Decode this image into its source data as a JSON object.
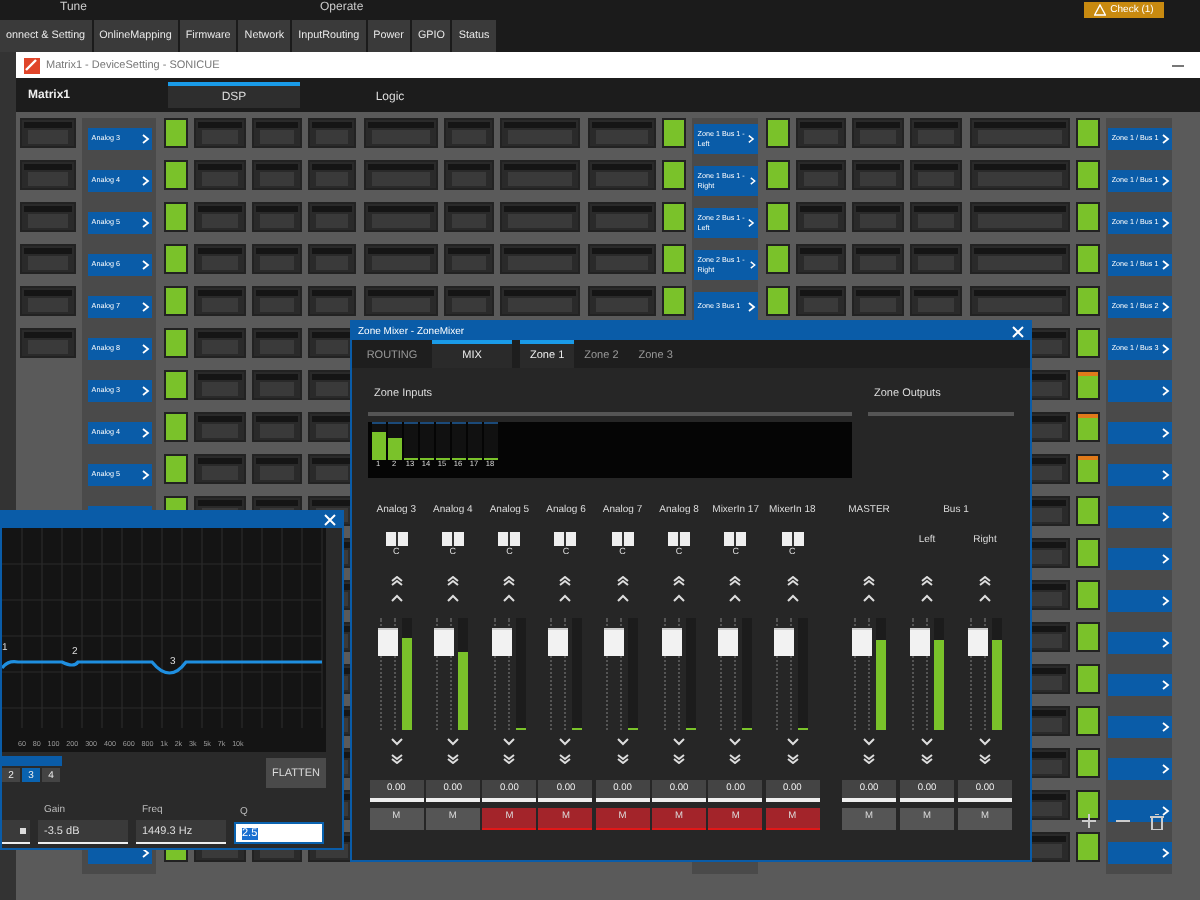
{
  "top_bar": {
    "items": [
      "Tune",
      "Operate"
    ],
    "check_button": "Check (1)"
  },
  "tabs": [
    {
      "label": "onnect & Setting",
      "selected": false
    },
    {
      "label": "OnlineMapping",
      "selected": false
    },
    {
      "label": "Firmware",
      "selected": false
    },
    {
      "label": "Network",
      "selected": false
    },
    {
      "label": "InputRouting",
      "selected": false
    },
    {
      "label": "Power",
      "selected": false
    },
    {
      "label": "GPIO",
      "selected": false
    },
    {
      "label": "Status",
      "selected": false
    }
  ],
  "window": {
    "title": "Matrix1 - DeviceSetting - SONICUE",
    "device": "Matrix1",
    "tabs": [
      {
        "label": "DSP",
        "selected": true
      },
      {
        "label": "Logic",
        "selected": false
      }
    ]
  },
  "matrix": {
    "rows": [
      {
        "input_block": true,
        "input_patch": "Analog 3",
        "zone_bus": "Zone 1 Bus 1 - Left",
        "output_patch": "Zone 1 / Bus 1",
        "clip": false
      },
      {
        "input_block": true,
        "input_patch": "Analog 4",
        "zone_bus": "Zone 1 Bus 1 - Right",
        "output_patch": "Zone 1 / Bus 1",
        "clip": false
      },
      {
        "input_block": true,
        "input_patch": "Analog 5",
        "zone_bus": "Zone 2 Bus 1 - Left",
        "output_patch": "Zone 1 / Bus 1",
        "clip": false
      },
      {
        "input_block": true,
        "input_patch": "Analog 6",
        "zone_bus": "Zone 2 Bus 1 - Right",
        "output_patch": "Zone 1 / Bus 1",
        "clip": false
      },
      {
        "input_block": true,
        "input_patch": "Analog 7",
        "zone_bus": "Zone 3 Bus 1",
        "output_patch": "Zone 1 / Bus 2",
        "clip": false
      },
      {
        "input_block": true,
        "input_patch": "Analog 8",
        "output_patch": "Zone 1 / Bus 3",
        "clip": false
      },
      {
        "input_block": false,
        "input_patch": "Analog 3",
        "clip": true
      },
      {
        "input_block": false,
        "input_patch": "Analog 4",
        "clip": true
      },
      {
        "input_block": false,
        "input_patch": "Analog 5",
        "clip": true
      },
      {
        "input_block": false,
        "clip": false
      },
      {
        "input_block": false,
        "clip": false
      },
      {
        "input_block": false,
        "clip": false
      },
      {
        "input_block": false,
        "clip": false
      },
      {
        "input_block": false,
        "clip": false
      },
      {
        "input_block": false,
        "clip": false
      },
      {
        "input_block": false,
        "clip": false
      },
      {
        "input_block": false,
        "clip": false
      },
      {
        "input_block": false,
        "clip": false
      }
    ]
  },
  "eq_window": {
    "points": [
      "1",
      "2",
      "3"
    ],
    "freq_labels": [
      "60",
      "80",
      "100",
      "200",
      "300",
      "400",
      "600",
      "800",
      "1k",
      "2k",
      "3k",
      "5k",
      "7k",
      "10k"
    ],
    "bands": [
      {
        "label": "2",
        "selected": false
      },
      {
        "label": "3",
        "selected": true
      },
      {
        "label": "4",
        "selected": false
      }
    ],
    "flatten": "FLATTEN",
    "fields": [
      {
        "label": "Gain",
        "value": "-3.5 dB",
        "focused": false
      },
      {
        "label": "Freq",
        "value": "1449.3 Hz",
        "focused": false
      },
      {
        "label": "Q",
        "value": "2.5",
        "focused": true
      }
    ]
  },
  "zone_mixer": {
    "title": "Zone Mixer - ZoneMixer",
    "view_tabs": [
      {
        "label": "ROUTING",
        "selected": false
      },
      {
        "label": "MIX",
        "selected": true
      }
    ],
    "zone_tabs": [
      {
        "label": "Zone 1",
        "selected": true
      },
      {
        "label": "Zone 2",
        "selected": false
      },
      {
        "label": "Zone 3",
        "selected": false
      }
    ],
    "inputs_heading": "Zone Inputs",
    "outputs_heading": "Zone Outputs",
    "input_meters": [
      {
        "label": "1",
        "level": 0.75
      },
      {
        "label": "2",
        "level": 0.6
      },
      {
        "label": "13",
        "level": 0
      },
      {
        "label": "14",
        "level": 0
      },
      {
        "label": "15",
        "level": 0
      },
      {
        "label": "16",
        "level": 0
      },
      {
        "label": "17",
        "level": 0
      },
      {
        "label": "18",
        "level": 0
      }
    ],
    "inputs": [
      {
        "name": "Analog 3",
        "pan": "C",
        "level": 0.82,
        "value": "0.00",
        "mute": "M",
        "muted": false
      },
      {
        "name": "Analog 4",
        "pan": "C",
        "level": 0.68,
        "value": "0.00",
        "mute": "M",
        "muted": false
      },
      {
        "name": "Analog 5",
        "pan": "C",
        "level": 0,
        "value": "0.00",
        "mute": "M",
        "muted": true
      },
      {
        "name": "Analog 6",
        "pan": "C",
        "level": 0,
        "value": "0.00",
        "mute": "M",
        "muted": true
      },
      {
        "name": "Analog 7",
        "pan": "C",
        "level": 0,
        "value": "0.00",
        "mute": "M",
        "muted": true
      },
      {
        "name": "Analog 8",
        "pan": "C",
        "level": 0,
        "value": "0.00",
        "mute": "M",
        "muted": true
      },
      {
        "name": "MixerIn 17",
        "pan": "C",
        "level": 0,
        "value": "0.00",
        "mute": "M",
        "muted": true
      },
      {
        "name": "MixerIn 18",
        "pan": "C",
        "level": 0,
        "value": "0.00",
        "mute": "M",
        "muted": true
      }
    ],
    "outputs": [
      {
        "heading": "MASTER",
        "channels": [
          {
            "level": 0.8,
            "value": "0.00",
            "mute": "M",
            "muted": false
          }
        ]
      },
      {
        "heading": "Bus 1",
        "channels": [
          {
            "name": "Left",
            "level": 0.8,
            "value": "0.00",
            "mute": "M",
            "muted": false
          },
          {
            "name": "Right",
            "level": 0.8,
            "value": "0.00",
            "mute": "M",
            "muted": false
          }
        ]
      }
    ]
  }
}
